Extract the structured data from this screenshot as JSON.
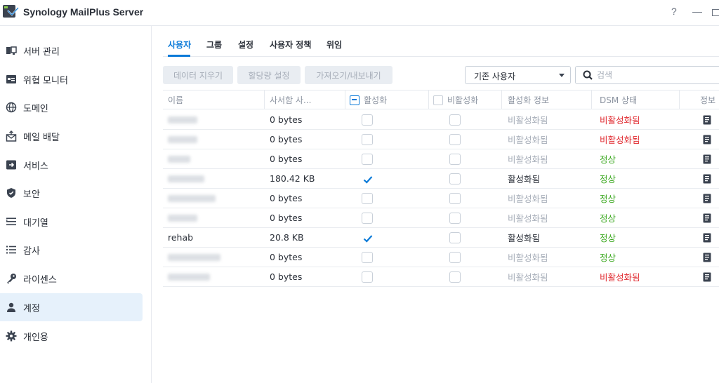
{
  "app": {
    "title": "Synology MailPlus Server",
    "help": "?",
    "minimize": "—"
  },
  "sidebar": {
    "items": [
      {
        "label": "서버 관리",
        "icon": "server-icon",
        "active": false
      },
      {
        "label": "위협 모니터",
        "icon": "monitor-icon",
        "active": false
      },
      {
        "label": "도메인",
        "icon": "globe-icon",
        "active": false
      },
      {
        "label": "메일 배달",
        "icon": "mail-upload-icon",
        "active": false
      },
      {
        "label": "서비스",
        "icon": "service-icon",
        "active": false
      },
      {
        "label": "보안",
        "icon": "shield-icon",
        "active": false
      },
      {
        "label": "대기열",
        "icon": "queue-icon",
        "active": false
      },
      {
        "label": "감사",
        "icon": "list-icon",
        "active": false
      },
      {
        "label": "라이센스",
        "icon": "key-icon",
        "active": false
      },
      {
        "label": "계정",
        "icon": "user-icon",
        "active": true
      },
      {
        "label": "개인용",
        "icon": "gear-icon",
        "active": false
      }
    ]
  },
  "tabs": [
    {
      "label": "사용자",
      "active": true
    },
    {
      "label": "그룹",
      "active": false
    },
    {
      "label": "설정",
      "active": false
    },
    {
      "label": "사용자 정책",
      "active": false
    },
    {
      "label": "위임",
      "active": false
    }
  ],
  "toolbar": {
    "clear_data": "데이터 지우기",
    "quota": "할당량 설정",
    "import_export": "가져오기/내보내기",
    "filter_value": "기존 사용자",
    "search_placeholder": "검색"
  },
  "table": {
    "headers": {
      "name": "이름",
      "mailbox": "사서함 사...",
      "active": "활성화",
      "inactive": "비활성화",
      "activation_info": "활성화 정보",
      "dsm_status": "DSM 상태",
      "info": "정보"
    },
    "rows": [
      {
        "name": "",
        "mailbox": "0 bytes",
        "active": false,
        "inactive": false,
        "activation_info": "비활성화됨",
        "dsm_status": "비활성화됨",
        "status_color": "#e0282e"
      },
      {
        "name": "",
        "mailbox": "0 bytes",
        "active": false,
        "inactive": false,
        "activation_info": "비활성화됨",
        "dsm_status": "비활성화됨",
        "status_color": "#e0282e"
      },
      {
        "name": "",
        "mailbox": "0 bytes",
        "active": false,
        "inactive": false,
        "activation_info": "비활성화됨",
        "dsm_status": "정상",
        "status_color": "#3aa71e"
      },
      {
        "name": "",
        "mailbox": "180.42 KB",
        "active": true,
        "inactive": false,
        "activation_info": "활성화됨",
        "dsm_status": "정상",
        "status_color": "#3aa71e"
      },
      {
        "name": "",
        "mailbox": "0 bytes",
        "active": false,
        "inactive": false,
        "activation_info": "비활성화됨",
        "dsm_status": "정상",
        "status_color": "#3aa71e"
      },
      {
        "name": "",
        "mailbox": "0 bytes",
        "active": false,
        "inactive": false,
        "activation_info": "비활성화됨",
        "dsm_status": "정상",
        "status_color": "#3aa71e"
      },
      {
        "name": "rehab",
        "mailbox": "20.8 KB",
        "active": true,
        "inactive": false,
        "activation_info": "활성화됨",
        "dsm_status": "정상",
        "status_color": "#3aa71e"
      },
      {
        "name": "",
        "mailbox": "0 bytes",
        "active": false,
        "inactive": false,
        "activation_info": "비활성화됨",
        "dsm_status": "정상",
        "status_color": "#3aa71e"
      },
      {
        "name": "",
        "mailbox": "0 bytes",
        "active": false,
        "inactive": false,
        "activation_info": "비활성화됨",
        "dsm_status": "비활성화됨",
        "status_color": "#e0282e"
      }
    ]
  },
  "colors": {
    "accent": "#0b7ad8",
    "error": "#e0282e",
    "ok": "#3aa71e",
    "active_nav_bg": "#e6f1fb"
  }
}
